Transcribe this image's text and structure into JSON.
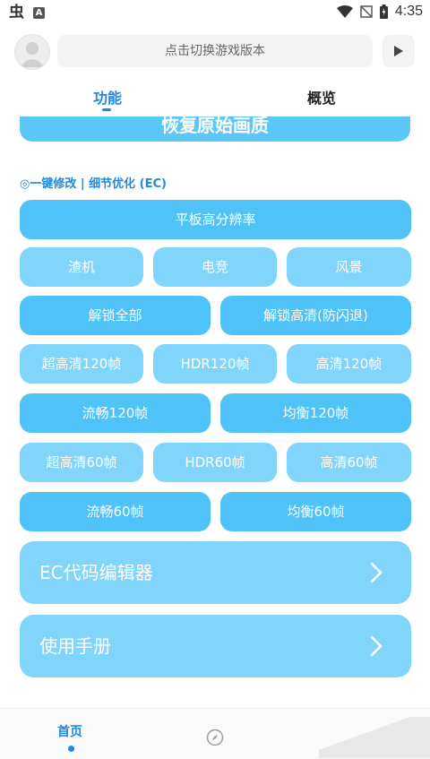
{
  "status_bar": {
    "time": "4:35",
    "logo": "虫",
    "notif_letter": "A"
  },
  "header": {
    "version_text": "点击切换游戏版本"
  },
  "tabs": [
    {
      "label": "功能"
    },
    {
      "label": "概览"
    }
  ],
  "main": {
    "restore_label": "恢复原始画质",
    "section_title": "◎一键修改 | 细节优化 (EC)",
    "tablet_label": "平板高分辨率",
    "row1": [
      "渣机",
      "电竞",
      "风景"
    ],
    "row2": [
      "解锁全部",
      "解锁高清(防闪退)"
    ],
    "row3": [
      "超高清120帧",
      "HDR120帧",
      "高清120帧"
    ],
    "row4": [
      "流畅120帧",
      "均衡120帧"
    ],
    "row5": [
      "超高清60帧",
      "HDR60帧",
      "高清60帧"
    ],
    "row6": [
      "流畅60帧",
      "均衡60帧"
    ],
    "ec_editor_label": "EC代码编辑器",
    "manual_label": "使用手册"
  },
  "bottom_nav": {
    "home_label": "首页"
  },
  "colors": {
    "accent": "#1e88e5",
    "button_dark": "#4fc3f7",
    "button_light": "#81d4fa"
  }
}
